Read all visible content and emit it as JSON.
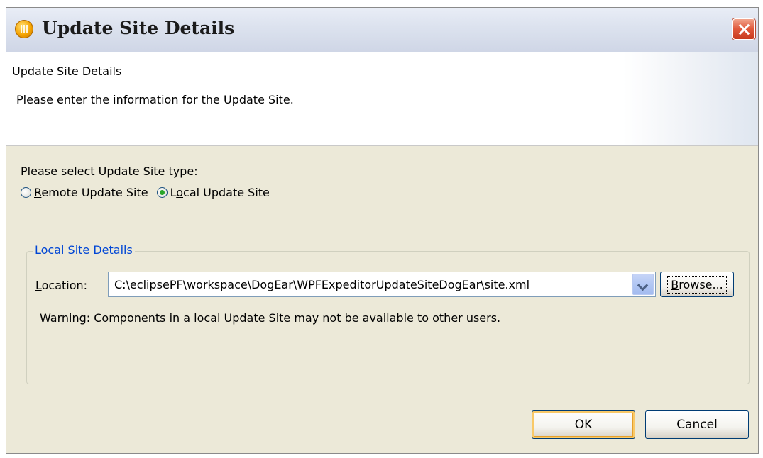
{
  "window": {
    "title": "Update Site Details"
  },
  "banner": {
    "title": "Update Site Details",
    "description": "Please enter the information for the Update Site."
  },
  "site_type": {
    "label": "Please select Update Site type:",
    "options": [
      {
        "mnemonic": "R",
        "rest": "emote Update Site",
        "selected": false
      },
      {
        "prefix": "L",
        "mnemonic": "o",
        "rest": "cal Update Site",
        "selected": true
      }
    ]
  },
  "local_site": {
    "group_title": "Local Site Details",
    "location_mnemonic": "L",
    "location_rest": "ocation:",
    "location_value": "C:\\eclipsePF\\workspace\\DogEar\\WPFExpeditorUpdateSiteDogEar\\site.xml",
    "browse_mnemonic": "B",
    "browse_rest": "rowse...",
    "warning": "Warning: Components in a local Update Site may not be available to other users."
  },
  "buttons": {
    "ok": "OK",
    "cancel": "Cancel"
  },
  "colors": {
    "group_title": "#0046d5",
    "default_button_ring": "#f9c968",
    "selected_radio": "#2aa62a"
  }
}
